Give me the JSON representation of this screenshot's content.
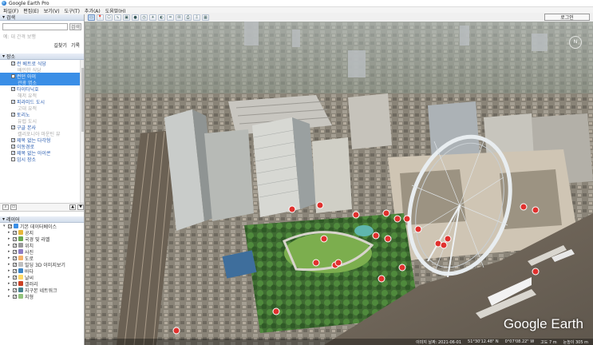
{
  "app": {
    "title": "Google Earth Pro"
  },
  "menu": [
    "파일(F)",
    "편집(E)",
    "보기(V)",
    "도구(T)",
    "추가(A)",
    "도움말(H)"
  ],
  "toolbar": {
    "login_label": "로그인"
  },
  "sidebar": {
    "search_header": "검색",
    "search_placeholder": "",
    "search_button": "검색",
    "search_hint": "예: 대 간격 보행",
    "links": [
      "길찾기",
      "기록"
    ],
    "places_header": "장소",
    "places": [
      {
        "label": "런 베트로 식당",
        "kind": "title",
        "checked": true
      },
      {
        "label": "배민한 식당",
        "kind": "sub"
      },
      {
        "label": "런던 아이",
        "kind": "title",
        "checked": true,
        "selected": true
      },
      {
        "label": "관광 명소",
        "kind": "sub",
        "selected": true
      },
      {
        "label": "타이타닉호",
        "kind": "title",
        "checked": true
      },
      {
        "label": "해저 유적",
        "kind": "sub"
      },
      {
        "label": "피라미드 도시",
        "kind": "title",
        "checked": true
      },
      {
        "label": "고대 유적",
        "kind": "sub"
      },
      {
        "label": "토리노",
        "kind": "title",
        "checked": true
      },
      {
        "label": "유럽 도시",
        "kind": "sub"
      },
      {
        "label": "구글 본사",
        "kind": "title",
        "checked": true
      },
      {
        "label": "캘리포니아 마운틴 뷰",
        "kind": "sub"
      },
      {
        "label": "제목 없는 다각형",
        "kind": "title",
        "checked": true
      },
      {
        "label": "이동경로",
        "kind": "title",
        "checked": true
      },
      {
        "label": "제목 없는 아이콘",
        "kind": "title",
        "checked": true
      },
      {
        "label": "임시 장소",
        "kind": "title",
        "checked": false
      }
    ],
    "layers_header": "레이어",
    "layers": [
      {
        "label": "기본 데이터베이스",
        "color": "#3a8ee6",
        "indent": 0
      },
      {
        "label": "공지",
        "color": "#e6b63a",
        "indent": 1
      },
      {
        "label": "국경 및 라벨",
        "color": "#6aa84f",
        "indent": 1
      },
      {
        "label": "위치",
        "color": "#999999",
        "indent": 1
      },
      {
        "label": "사진",
        "color": "#8e7cc3",
        "indent": 1
      },
      {
        "label": "도로",
        "color": "#f6b26b",
        "indent": 1
      },
      {
        "label": "빌딩 3D 이미지보기",
        "color": "#bfbfbf",
        "indent": 1
      },
      {
        "label": "바다",
        "color": "#3d85c6",
        "indent": 1
      },
      {
        "label": "날씨",
        "color": "#ffd966",
        "indent": 1
      },
      {
        "label": "갤러리",
        "color": "#cc4125",
        "indent": 1
      },
      {
        "label": "지구본 네트워크",
        "color": "#45818e",
        "indent": 1
      },
      {
        "label": "지형",
        "color": "#93c47d",
        "indent": 1
      }
    ]
  },
  "map": {
    "watermark": "Google Earth",
    "status": [
      "이미지 날짜: 2021-06-01",
      "51°30'12.48\" N",
      "0°07'08.22\" W",
      "고도 7 m",
      "눈높이 305 m"
    ],
    "compass": "N"
  }
}
